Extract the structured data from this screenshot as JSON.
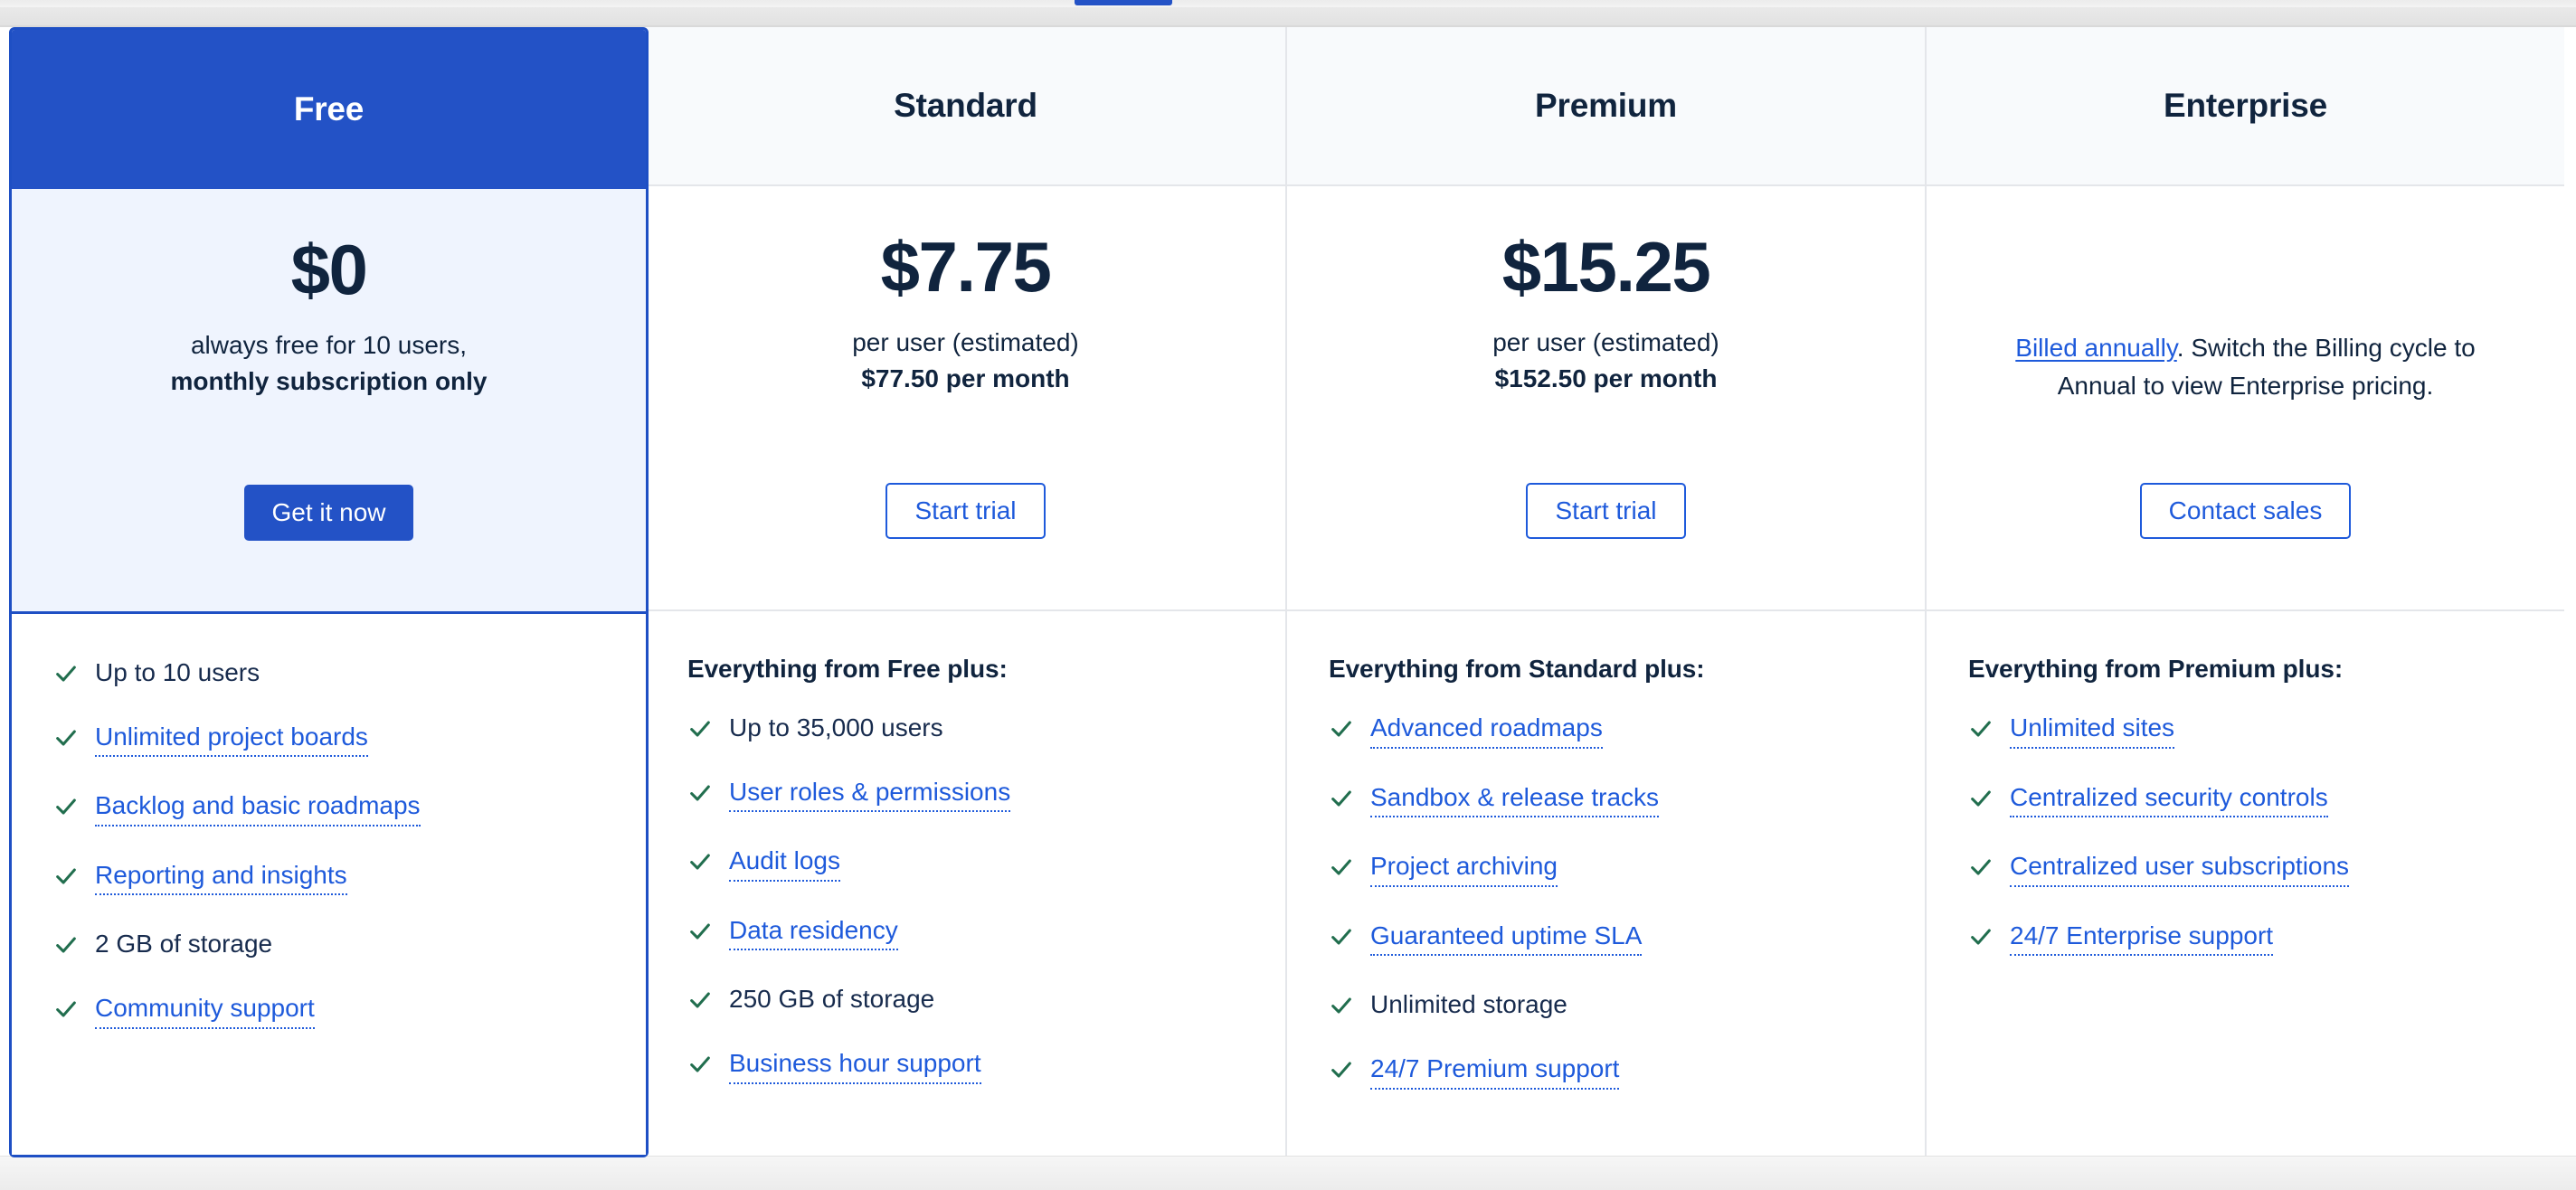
{
  "accent_blue": "#2352C6",
  "link_blue": "#1E5ADB",
  "check_green": "#216E4E",
  "text_navy": "#10243E",
  "header_bg": "#F8FAFC",
  "highlight_panel_bg": "#EFF4FE",
  "plans": [
    {
      "name": "Free",
      "highlighted": true,
      "price": "$0",
      "price_sub": "always free for 10 users,",
      "price_sub_strong": "monthly subscription only",
      "cta_label": "Get it now",
      "cta_style": "primary",
      "features_heading": "",
      "features": [
        {
          "label": "Up to 10 users",
          "link": false
        },
        {
          "label": "Unlimited project boards",
          "link": true
        },
        {
          "label": "Backlog and basic roadmaps",
          "link": true
        },
        {
          "label": "Reporting and insights",
          "link": true
        },
        {
          "label": "2 GB of storage",
          "link": false
        },
        {
          "label": "Community support",
          "link": true
        }
      ]
    },
    {
      "name": "Standard",
      "highlighted": false,
      "price": "$7.75",
      "price_sub": "per user (estimated)",
      "price_sub_strong": "$77.50 per month",
      "cta_label": "Start trial",
      "cta_style": "secondary",
      "features_heading": "Everything from Free plus:",
      "features": [
        {
          "label": "Up to 35,000 users",
          "link": false
        },
        {
          "label": "User roles & permissions",
          "link": true
        },
        {
          "label": "Audit logs",
          "link": true
        },
        {
          "label": "Data residency",
          "link": true
        },
        {
          "label": "250 GB of storage",
          "link": false
        },
        {
          "label": "Business hour support",
          "link": true
        }
      ]
    },
    {
      "name": "Premium",
      "highlighted": false,
      "price": "$15.25",
      "price_sub": "per user (estimated)",
      "price_sub_strong": "$152.50 per month",
      "cta_label": "Start trial",
      "cta_style": "secondary",
      "features_heading": "Everything from Standard plus:",
      "features": [
        {
          "label": "Advanced roadmaps",
          "link": true
        },
        {
          "label": "Sandbox & release tracks",
          "link": true
        },
        {
          "label": "Project archiving",
          "link": true
        },
        {
          "label": "Guaranteed uptime SLA",
          "link": true
        },
        {
          "label": "Unlimited storage",
          "link": false
        },
        {
          "label": "24/7 Premium support",
          "link": true
        }
      ]
    },
    {
      "name": "Enterprise",
      "highlighted": false,
      "price": "",
      "price_note_link": "Billed annually",
      "price_note_rest": ". Switch the Billing cycle to Annual to view Enterprise pricing.",
      "cta_label": "Contact sales",
      "cta_style": "secondary",
      "features_heading": "Everything from Premium plus:",
      "features": [
        {
          "label": "Unlimited sites",
          "link": true
        },
        {
          "label": "Centralized security controls",
          "link": true
        },
        {
          "label": "Centralized user subscriptions",
          "link": true
        },
        {
          "label": "24/7 Enterprise support",
          "link": true
        }
      ]
    }
  ]
}
